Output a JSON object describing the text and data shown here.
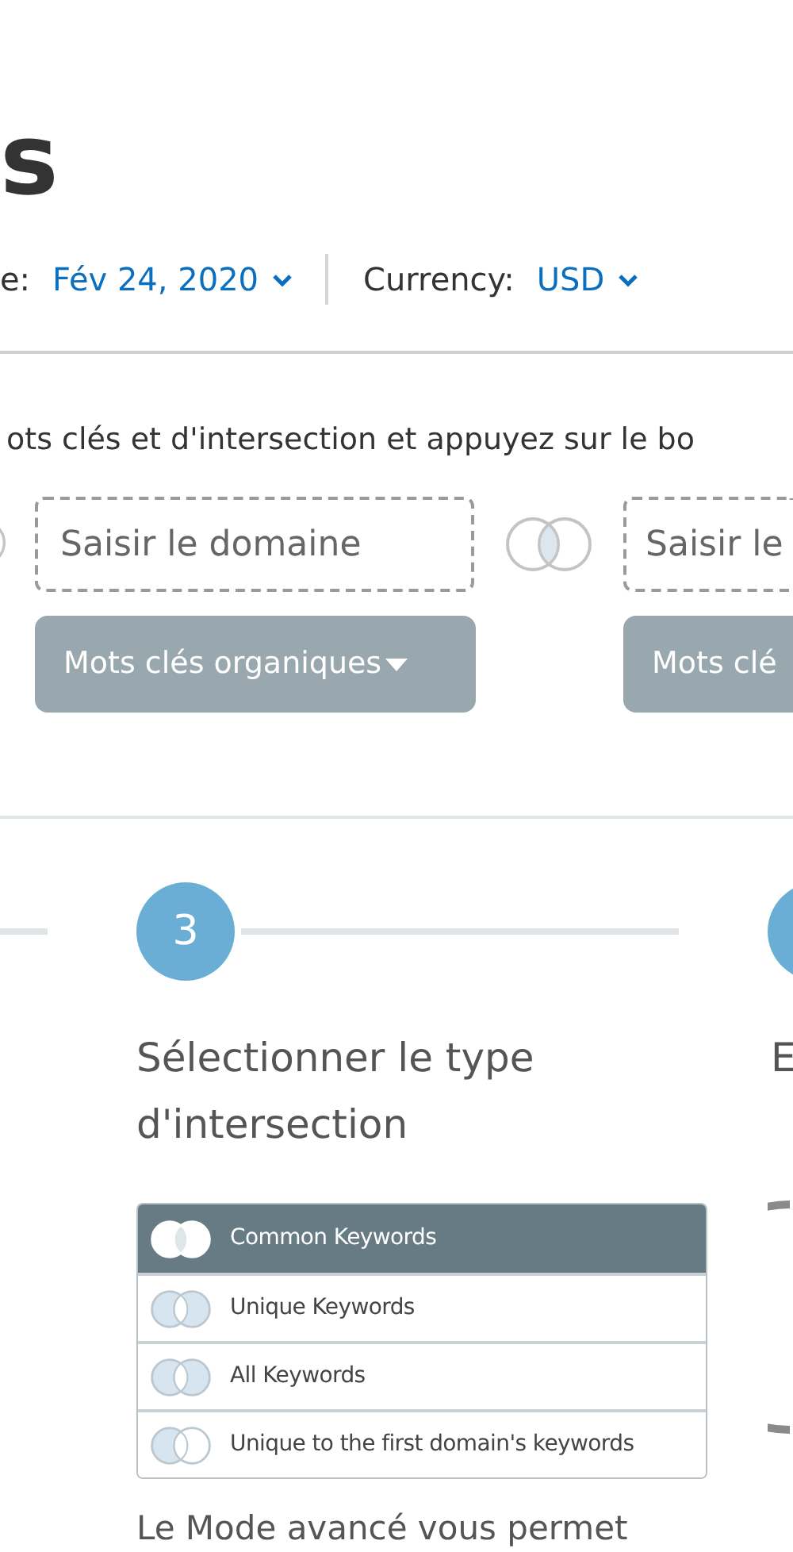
{
  "header": {
    "title": "s",
    "date_label": "e:",
    "date": "Fév 24, 2020",
    "currency_label": "Currency:",
    "currency": "USD"
  },
  "instruction": "ots clés et d'intersection et appuyez sur le bo",
  "domains": [
    {
      "placeholder": "Saisir le domaine",
      "type_button": "Mots clés organiques"
    },
    {
      "placeholder": "Saisir le",
      "type_button": "Mots clé"
    }
  ],
  "step": {
    "number": "3",
    "title": "Sélectionner le type d'intersection",
    "options": [
      {
        "label": "Common Keywords",
        "selected": true
      },
      {
        "label": "Unique Keywords",
        "selected": false
      },
      {
        "label": "All Keywords",
        "selected": false
      },
      {
        "label": "Unique to the first domain's keywords",
        "selected": false
      }
    ],
    "description": "Le Mode avancé vous permet"
  },
  "next_step": {
    "title": "E"
  }
}
